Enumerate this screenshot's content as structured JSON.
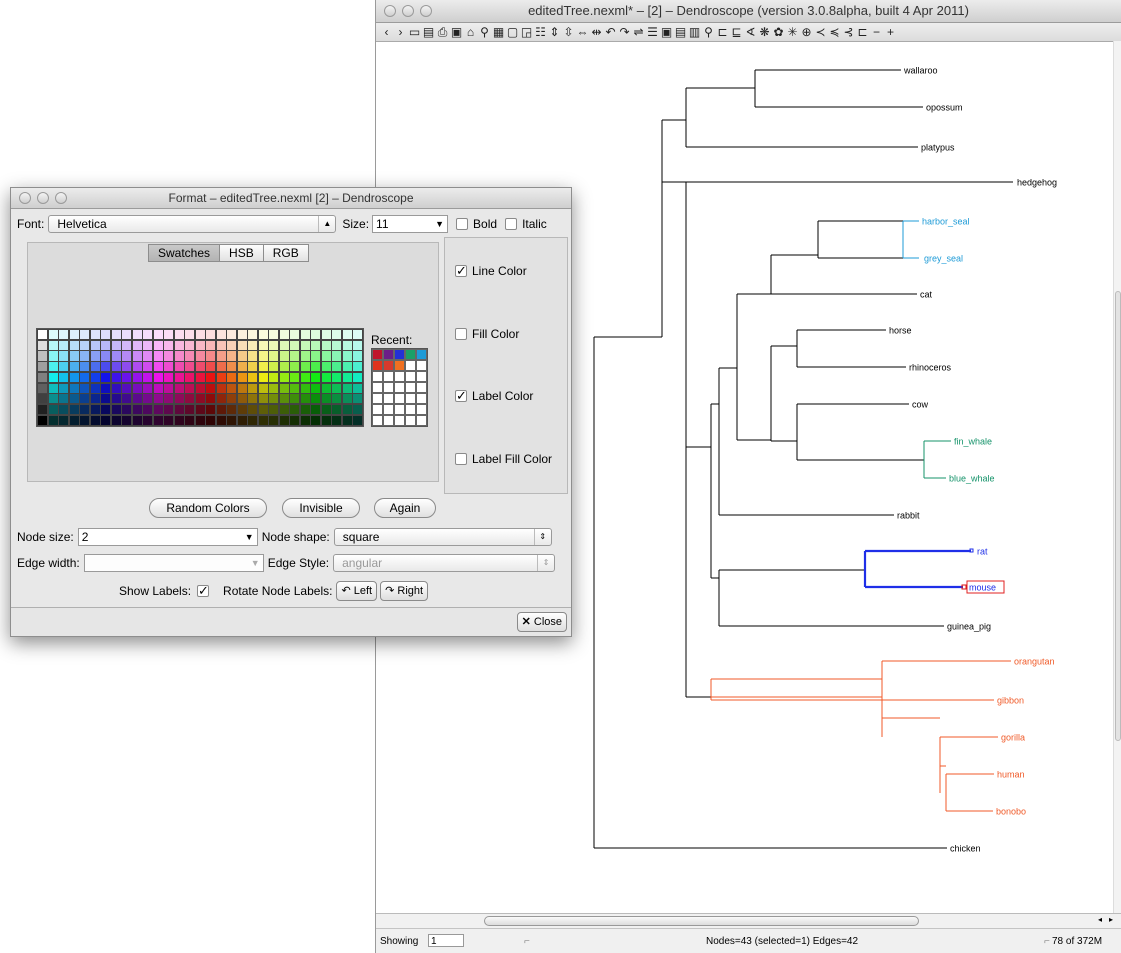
{
  "main_window": {
    "title": "editedTree.nexml* – [2] – Dendroscope (version 3.0.8alpha, built 4 Apr 2011)",
    "toolbar_icons": [
      "back-icon",
      "forward-icon",
      "open-icon",
      "save-icon",
      "print-icon",
      "export-icon",
      "home-icon",
      "find-icon",
      "grid-icon",
      "window-icon",
      "select-icon",
      "list-icon",
      "expand-vertical-icon",
      "contract-vertical-icon",
      "expand-horizontal-icon",
      "contract-horizontal-icon",
      "rotate-left-icon",
      "rotate-right-icon",
      "flip-icon",
      "text-icon",
      "layout-icon",
      "layout2-icon",
      "layout3-icon",
      "zoom-icon",
      "rectangular-phylogram-icon",
      "rectangular-cladogram-icon",
      "slanted-icon",
      "circular-phylogram-icon",
      "circular-cladogram-icon",
      "radial-icon",
      "network-icon",
      "inner-circular-icon",
      "left-cladogram-icon",
      "internal-labels-icon",
      "ladderize-icon",
      "minus-icon",
      "plus-icon"
    ],
    "status": {
      "showing_label": "Showing",
      "showing_value": "1",
      "counts": "Nodes=43 (selected=1) Edges=42",
      "memory": "78 of 372M"
    }
  },
  "tree": {
    "colors": {
      "default": "#000000",
      "seal": "#1e9bd7",
      "whale": "#15936a",
      "rodent": "#1f2fe8",
      "ape": "#f05a28"
    },
    "taxa": {
      "wallaroo": "wallaroo",
      "opossum": "opossum",
      "platypus": "platypus",
      "hedgehog": "hedgehog",
      "harbor_seal": "harbor_seal",
      "grey_seal": "grey_seal",
      "cat": "cat",
      "horse": "horse",
      "rhinoceros": "rhinoceros",
      "cow": "cow",
      "fin_whale": "fin_whale",
      "blue_whale": "blue_whale",
      "rabbit": "rabbit",
      "rat": "rat",
      "mouse": "mouse",
      "guinea_pig": "guinea_pig",
      "orangutan": "orangutan",
      "gibbon": "gibbon",
      "gorilla": "gorilla",
      "human": "human",
      "bonobo": "bonobo",
      "chicken": "chicken"
    }
  },
  "dialog": {
    "title": "Format – editedTree.nexml [2] – Dendroscope",
    "font_label": "Font:",
    "font_value": "Helvetica",
    "size_label": "Size:",
    "size_value": "11",
    "bold_label": "Bold",
    "italic_label": "Italic",
    "tabs": [
      "Swatches",
      "HSB",
      "RGB"
    ],
    "recent_label": "Recent:",
    "recent_colors": [
      "#c0152b",
      "#6c1e88",
      "#2331d6",
      "#1aa067",
      "#1e9bd7",
      "#e0331c",
      "#d63a2d",
      "#f07020"
    ],
    "color_options": [
      {
        "label": "Line Color",
        "checked": true
      },
      {
        "label": "Fill Color",
        "checked": false
      },
      {
        "label": "Label Color",
        "checked": true
      },
      {
        "label": "Label Fill Color",
        "checked": false
      }
    ],
    "random_colors_label": "Random Colors",
    "invisible_label": "Invisible",
    "again_label": "Again",
    "node_size_label": "Node size:",
    "node_size_value": "2",
    "node_shape_label": "Node shape:",
    "node_shape_value": "square",
    "edge_width_label": "Edge width:",
    "edge_width_value": "",
    "edge_style_label": "Edge Style:",
    "edge_style_value": "angular",
    "show_labels_label": "Show Labels:",
    "rotate_label": "Rotate Node Labels:",
    "left_label": "Left",
    "right_label": "Right",
    "close_label": "Close"
  }
}
